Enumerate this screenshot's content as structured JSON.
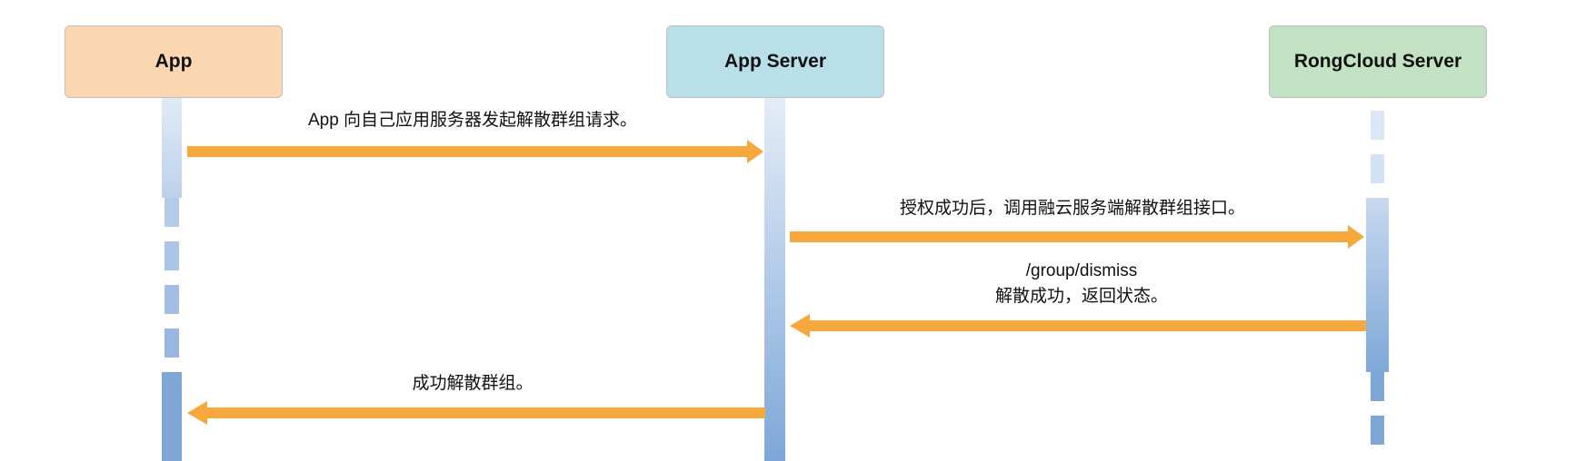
{
  "participants": [
    {
      "name": "App",
      "color": "#fbd7b1"
    },
    {
      "name": "App Server",
      "color": "#b9dfe8"
    },
    {
      "name": "RongCloud Server",
      "color": "#c3e2c4"
    }
  ],
  "messages": {
    "m1": "App 向自己应用服务器发起解散群组请求。",
    "m2": "授权成功后，调用融云服务端解散群组接口。",
    "m3_line1": "/group/dismiss",
    "m3_line2": "解散成功，返回状态。",
    "m4": "成功解散群组。"
  },
  "colors": {
    "arrow": "#f6a83c",
    "lifeline_dark": "#7ea7d8",
    "lifeline_light": "#dce8f5"
  }
}
